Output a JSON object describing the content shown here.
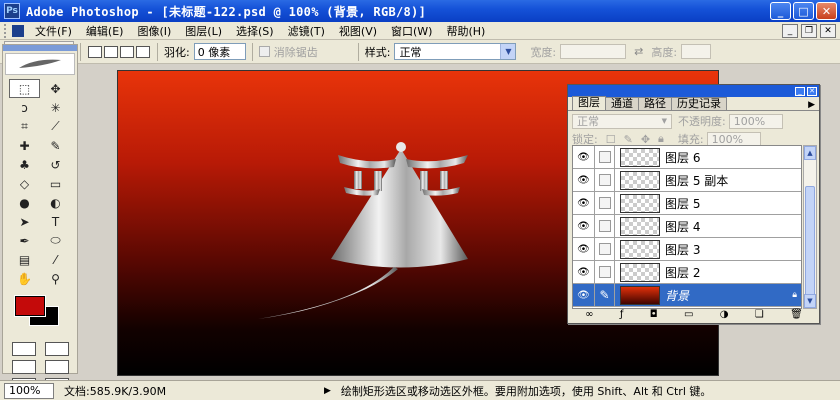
{
  "window": {
    "title": "Adobe Photoshop - [未标题-122.psd @ 100% (背景, RGB/8)]"
  },
  "menu": [
    "文件(F)",
    "编辑(E)",
    "图像(I)",
    "图层(L)",
    "选择(S)",
    "滤镜(T)",
    "视图(V)",
    "窗口(W)",
    "帮助(H)"
  ],
  "options": {
    "feather_label": "羽化:",
    "feather_value": "0 像素",
    "antialias_label": "消除锯齿",
    "style_label": "样式:",
    "style_value": "正常",
    "width_label": "宽度:",
    "height_label": "高度:"
  },
  "layers_panel": {
    "tabs": [
      "图层",
      "通道",
      "路径",
      "历史记录"
    ],
    "blend_mode": "正常",
    "opacity_label": "不透明度:",
    "opacity_value": "100%",
    "lock_label": "锁定:",
    "fill_label": "填充:",
    "fill_value": "100%",
    "layers": [
      {
        "name": "图层 6",
        "active": false
      },
      {
        "name": "图层 5 副本",
        "active": false
      },
      {
        "name": "图层 5",
        "active": false
      },
      {
        "name": "图层 4",
        "active": false
      },
      {
        "name": "图层 3",
        "active": false
      },
      {
        "name": "图层 2",
        "active": false
      },
      {
        "name": "背景",
        "active": true
      }
    ]
  },
  "colors": {
    "foreground": "#c40a0a",
    "background": "#000000"
  },
  "status": {
    "zoom": "100%",
    "doc_info": "文档:585.9K/3.90M",
    "hint": "绘制矩形选区或移动选区外框。要用附加选项，使用 Shift、Alt 和 Ctrl 键。"
  }
}
